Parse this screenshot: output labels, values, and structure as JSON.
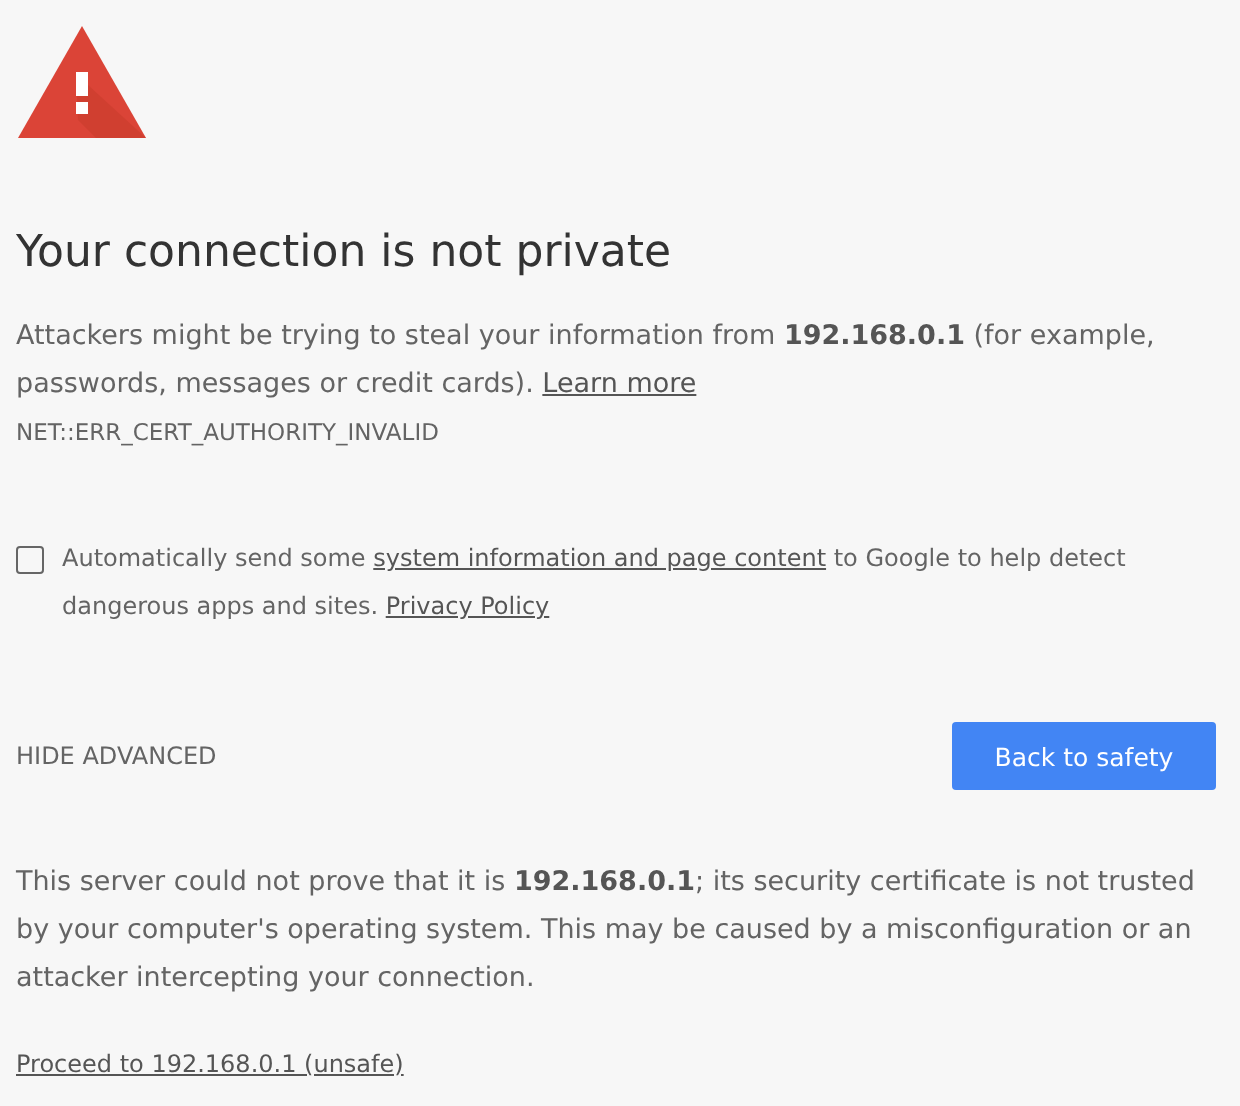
{
  "heading": "Your connection is not private",
  "intro": {
    "text": "Attackers might be trying to steal your information from **192.168.0.1** (for example, passwords, messages or credit cards).",
    "link": "Learn more"
  },
  "error_code": "NET::ERR_CERT_AUTHORITY_INVALID",
  "report_opt_in": {
    "checked": false,
    "text_before": "Automatically send some",
    "link": "system information and page content",
    "text_after": "to Google to help detect dangerous apps and sites.",
    "policy_link": "Privacy Policy"
  },
  "advanced_toggle": "HIDE ADVANCED",
  "back_button": "Back to safety",
  "details": "This server could not prove that it is **192.168.0.1**; its security certificate is not trusted by your computer's operating system. This may be caused by a misconfiguration or an attacker intercepting your connection.",
  "proceed_link": "Proceed to 192.168.0.1 (unsafe)"
}
